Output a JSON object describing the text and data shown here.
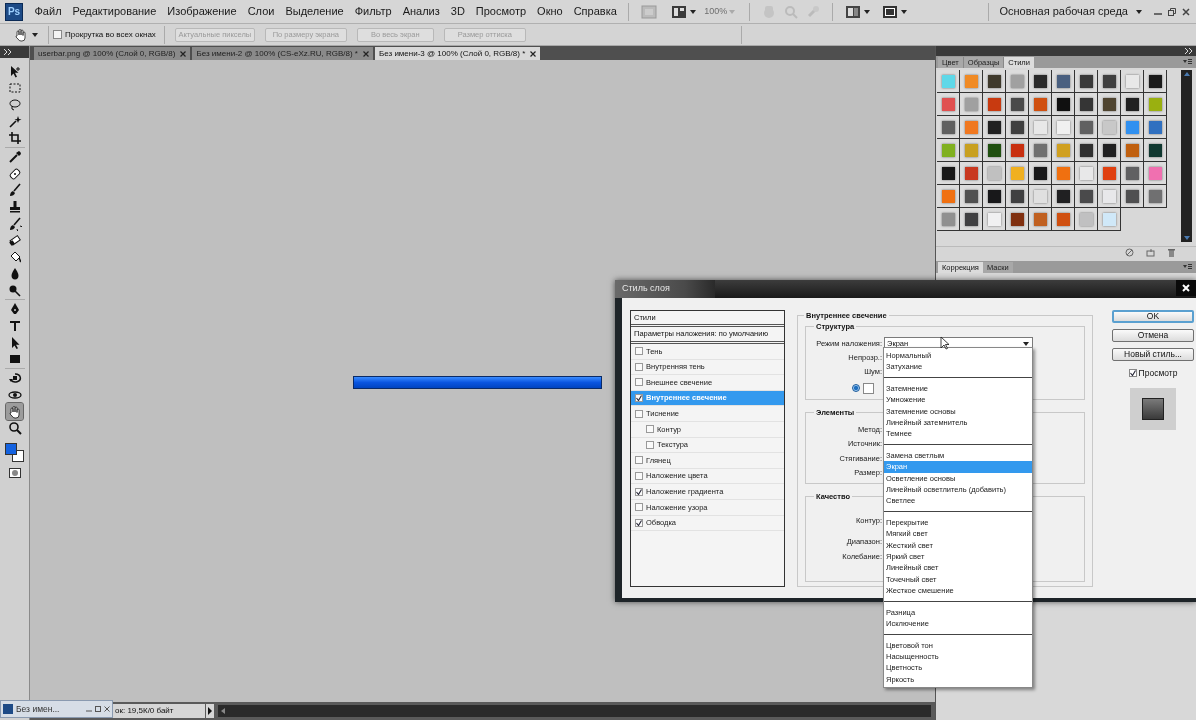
{
  "app": {
    "logo": "Ps"
  },
  "menu": [
    "Файл",
    "Редактирование",
    "Изображение",
    "Слои",
    "Выделение",
    "Фильтр",
    "Анализ",
    "3D",
    "Просмотр",
    "Окно",
    "Справка"
  ],
  "zoom": "100%",
  "workspace": "Основная рабочая среда",
  "options": {
    "scroll_all": {
      "label": "Прокрутка во всех окнах",
      "checked": false
    },
    "buttons": [
      {
        "label": "Актуальные пикселы",
        "disabled": true
      },
      {
        "label": "По размеру экрана",
        "disabled": true
      },
      {
        "label": "Во весь экран",
        "disabled": true
      },
      {
        "label": "Размер оттиска",
        "disabled": true
      }
    ]
  },
  "tabs": [
    {
      "label": "userbar.png @ 100% (Слой 0, RGB/8)",
      "selected": false
    },
    {
      "label": "Без имени-2 @ 100% (CS-eXz.RU, RGB/8) *",
      "selected": false
    },
    {
      "label": "Без имени-3 @ 100% (Слой 0, RGB/8) *",
      "selected": true
    }
  ],
  "tools": [
    {
      "kind": "move",
      "selected": false
    },
    {
      "kind": "marquee",
      "selected": false
    },
    {
      "kind": "lasso",
      "selected": false
    },
    {
      "kind": "wand",
      "selected": false
    },
    {
      "kind": "crop",
      "selected": false
    },
    {
      "kind": "eyedropper",
      "selected": false
    },
    {
      "kind": "healing",
      "selected": false
    },
    {
      "kind": "brush",
      "selected": false
    },
    {
      "kind": "stamp",
      "selected": false
    },
    {
      "kind": "history",
      "selected": false
    },
    {
      "kind": "eraser",
      "selected": false
    },
    {
      "kind": "bucket",
      "selected": false
    },
    {
      "kind": "blur",
      "selected": false
    },
    {
      "kind": "dodge",
      "selected": false
    },
    {
      "kind": "pen",
      "selected": false
    },
    {
      "kind": "type",
      "selected": false
    },
    {
      "kind": "select",
      "selected": false
    },
    {
      "kind": "shape",
      "selected": false
    },
    {
      "kind": "rotate3d",
      "selected": false
    },
    {
      "kind": "orbit3d",
      "selected": false
    },
    {
      "kind": "hand",
      "selected": true
    },
    {
      "kind": "zoom",
      "selected": false
    }
  ],
  "colors": [
    {
      "kind": "foreground",
      "color": "#1462e0"
    },
    {
      "kind": "background",
      "color": "#ffffff"
    }
  ],
  "panel_tabs": [
    {
      "label": "Цвет",
      "selected": false
    },
    {
      "label": "Образцы",
      "selected": false
    },
    {
      "label": "Стили",
      "selected": true
    }
  ],
  "swatch_rows": [
    {
      "swatches": [
        {
          "color": "#5fd8e8"
        },
        {
          "color": "#f08a24"
        },
        {
          "color": "#3f3a2c"
        },
        {
          "color": "#a0a0a0"
        },
        {
          "color": "#2a2a2a"
        },
        {
          "color": "#4a6080"
        },
        {
          "color": "#3a3a3a"
        },
        {
          "color": "#404040"
        },
        {
          "color": "#e8e8e8"
        },
        {
          "color": "#1a1a1a"
        }
      ]
    },
    {
      "swatches": [
        {
          "color": "#e05050"
        },
        {
          "color": "#a0a0a0"
        },
        {
          "color": "#c83a10"
        },
        {
          "color": "#4a4a4a"
        },
        {
          "color": "#d05010"
        },
        {
          "color": "#101010"
        },
        {
          "color": "#353535"
        },
        {
          "color": "#504530"
        },
        {
          "color": "#202020"
        },
        {
          "color": "#9ab010"
        }
      ]
    },
    {
      "swatches": [
        {
          "color": "#606060"
        },
        {
          "color": "#f07820"
        },
        {
          "color": "#202020"
        },
        {
          "color": "#404040"
        },
        {
          "color": "#e8e8e8"
        },
        {
          "color": "#f0f0f0"
        },
        {
          "color": "#606061"
        },
        {
          "color": "#c8c8c8"
        },
        {
          "color": "#3090f0"
        },
        {
          "color": "#3070c0"
        }
      ]
    },
    {
      "swatches": [
        {
          "color": "#80b020"
        },
        {
          "color": "#c8a020"
        },
        {
          "color": "#205010"
        },
        {
          "color": "#c83010"
        },
        {
          "color": "#707070"
        },
        {
          "color": "#d0a020"
        },
        {
          "color": "#303030"
        },
        {
          "color": "#202021"
        },
        {
          "color": "#c06010"
        },
        {
          "color": "#103830"
        }
      ]
    },
    {
      "swatches": [
        {
          "color": "#181818"
        },
        {
          "color": "#c83820"
        },
        {
          "color": "#c0c0c0"
        },
        {
          "color": "#f0b020"
        },
        {
          "color": "#181819"
        },
        {
          "color": "#f07010"
        },
        {
          "color": "#e8e8e9"
        },
        {
          "color": "#e04010"
        },
        {
          "color": "#606062"
        },
        {
          "color": "#f070b0"
        }
      ]
    },
    {
      "swatches": [
        {
          "color": "#f07011"
        },
        {
          "color": "#505050"
        },
        {
          "color": "#18181a"
        },
        {
          "color": "#404041"
        },
        {
          "color": "#e0e0e0"
        },
        {
          "color": "#202022"
        },
        {
          "color": "#4a4a4b"
        },
        {
          "color": "#e8e8ea"
        },
        {
          "color": "#505051"
        },
        {
          "color": "#707071"
        }
      ]
    },
    {
      "swatches": [
        {
          "color": "#909090"
        },
        {
          "color": "#404042"
        },
        {
          "color": "#f0f0f1"
        },
        {
          "color": "#803010"
        },
        {
          "color": "#c06020"
        },
        {
          "color": "#d05011"
        },
        {
          "color": "#c0c0c1"
        },
        {
          "color": "#d0e8f8"
        }
      ]
    }
  ],
  "lower_panel_tabs": [
    {
      "label": "Коррекция",
      "selected": true
    },
    {
      "label": "Маски",
      "selected": false
    }
  ],
  "dialog": {
    "title": "Стиль слоя",
    "styles_header": "Стили",
    "blending": "Параметры наложения: по умолчанию",
    "effects": [
      {
        "label": "Тень",
        "checked": false,
        "selected": false
      },
      {
        "label": "Внутренняя тень",
        "checked": false,
        "selected": false
      },
      {
        "label": "Внешнее свечение",
        "checked": false,
        "selected": false
      },
      {
        "label": "Внутреннее свечение",
        "checked": true,
        "selected": true
      },
      {
        "label": "Тиснение",
        "checked": false,
        "selected": false,
        "children": [
          {
            "label": "Контур",
            "checked": false,
            "selected": false
          },
          {
            "label": "Текстура",
            "checked": false,
            "selected": false
          }
        ]
      },
      {
        "label": "Глянец",
        "checked": false,
        "selected": false
      },
      {
        "label": "Наложение цвета",
        "checked": false,
        "selected": false
      },
      {
        "label": "Наложение градиента",
        "checked": true,
        "selected": false
      },
      {
        "label": "Наложение узора",
        "checked": false,
        "selected": false
      },
      {
        "label": "Обводка",
        "checked": true,
        "selected": false
      }
    ],
    "section_title": "Внутреннее свечение",
    "structure": {
      "title": "Структура",
      "blend_mode": {
        "label": "Режим наложения:",
        "value": "Экран"
      },
      "labels": [
        "Непрозр.:",
        "Шум:"
      ],
      "color_radio_selected": true
    },
    "elements": {
      "title": "Элементы",
      "labels": [
        "Метод:",
        "Источник:",
        "Стягивание:",
        "Размер:"
      ]
    },
    "quality": {
      "title": "Качество",
      "labels": [
        "Контур:",
        "Диапазон:",
        "Колебание:"
      ]
    },
    "buttons": [
      {
        "label": "OK",
        "default": true
      },
      {
        "label": "Отмена",
        "default": false
      },
      {
        "label": "Новый стиль...",
        "default": false
      }
    ],
    "preview": {
      "label": "Просмотр",
      "checked": true
    }
  },
  "dropdown": {
    "groups": [
      {
        "options": [
          {
            "label": "Нормальный",
            "selected": false
          },
          {
            "label": "Затухание",
            "selected": false
          }
        ]
      },
      {
        "options": [
          {
            "label": "Затемнение",
            "selected": false
          },
          {
            "label": "Умножение",
            "selected": false
          },
          {
            "label": "Затемнение основы",
            "selected": false
          },
          {
            "label": "Линейный затемнитель",
            "selected": false
          },
          {
            "label": "Темнее",
            "selected": false
          }
        ]
      },
      {
        "options": [
          {
            "label": "Замена светлым",
            "selected": false
          },
          {
            "label": "Экран",
            "selected": true
          },
          {
            "label": "Осветление основы",
            "selected": false
          },
          {
            "label": "Линейный осветлитель (добавить)",
            "selected": false
          },
          {
            "label": "Светлее",
            "selected": false
          }
        ]
      },
      {
        "options": [
          {
            "label": "Перекрытие",
            "selected": false
          },
          {
            "label": "Мягкий свет",
            "selected": false
          },
          {
            "label": "Жесткий свет",
            "selected": false
          },
          {
            "label": "Яркий свет",
            "selected": false
          },
          {
            "label": "Линейный свет",
            "selected": false
          },
          {
            "label": "Точечный свет",
            "selected": false
          },
          {
            "label": "Жесткое смешение",
            "selected": false
          }
        ]
      },
      {
        "options": [
          {
            "label": "Разница",
            "selected": false
          },
          {
            "label": "Исключение",
            "selected": false
          }
        ]
      },
      {
        "options": [
          {
            "label": "Цветовой тон",
            "selected": false
          },
          {
            "label": "Насыщенность",
            "selected": false
          },
          {
            "label": "Цветность",
            "selected": false
          },
          {
            "label": "Яркость",
            "selected": false
          }
        ]
      }
    ]
  },
  "status": {
    "doc": "ок: 19,5К/0 байт"
  },
  "taskbar": {
    "title": "Без имен..."
  }
}
